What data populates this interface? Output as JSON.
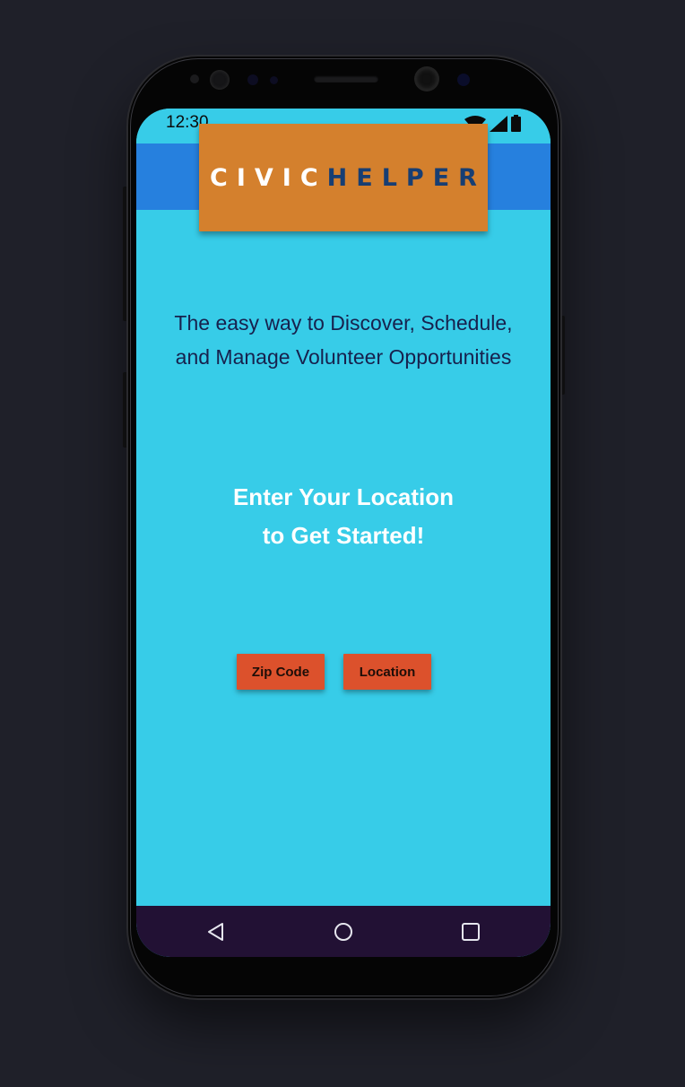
{
  "status_bar": {
    "time": "12:30",
    "icons": [
      "wifi-icon",
      "cell-signal-icon",
      "battery-icon"
    ]
  },
  "app": {
    "logo": {
      "part1": "CIVIC",
      "part2": "HELPER",
      "part1_color": "#ffffff",
      "part2_color": "#173e73",
      "background": "#d4802d"
    },
    "header_color": "#2680de",
    "background_color": "#37cce8"
  },
  "tagline": {
    "line1": "The easy way to Discover, Schedule,",
    "line2": "and Manage Volunteer Opportunities"
  },
  "call_to_action": {
    "line1": "Enter Your Location",
    "line2": "to Get Started!"
  },
  "buttons": {
    "zip_code": "Zip Code",
    "location": "Location",
    "color": "#dc512c"
  },
  "nav_bar": {
    "items": [
      "back-icon",
      "home-icon",
      "recents-icon"
    ]
  }
}
